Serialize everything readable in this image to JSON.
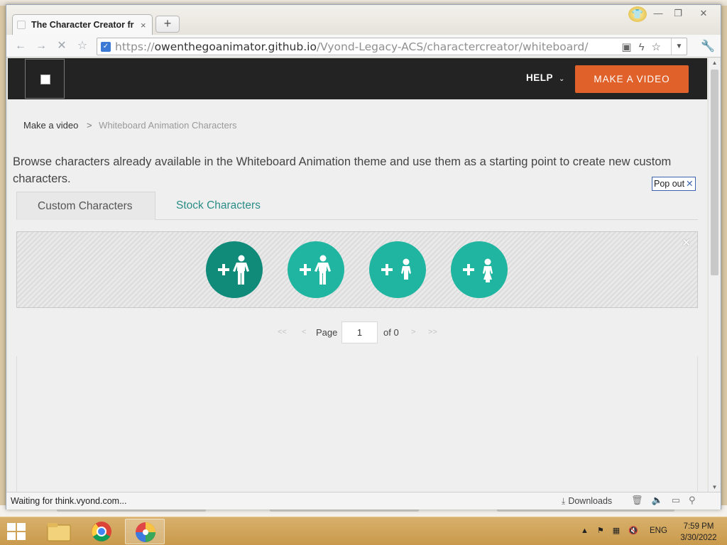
{
  "browser": {
    "tab_title": "The Character Creator fr",
    "tab_close": "×",
    "new_tab": "+",
    "url_scheme": "https://",
    "url_host": "owenthegoanimator.github.io",
    "url_path": "/Vyond-Legacy-ACS/charactercreator/whiteboard/",
    "window_controls": [
      "—",
      "❐",
      "✕"
    ],
    "status_text": "Waiting for think.vyond.com...",
    "downloads_label": "Downloads"
  },
  "site_header": {
    "help_label": "HELP",
    "make_video_label": "MAKE A VIDEO"
  },
  "breadcrumb": {
    "home": "Make a video",
    "separator": ">",
    "current": "Whiteboard Animation Characters"
  },
  "intro_text": "Browse characters already available in the Whiteboard Animation theme and use them as a starting point to create new custom characters.",
  "popout": {
    "label": "Pop out",
    "close": "✕"
  },
  "tabs": [
    {
      "label": "Custom Characters",
      "active": true
    },
    {
      "label": "Stock Characters",
      "active": false
    }
  ],
  "character_buttons": [
    {
      "icon": "add-adult-character-icon"
    },
    {
      "icon": "add-adult-character-icon"
    },
    {
      "icon": "add-child-character-icon"
    },
    {
      "icon": "add-child-character-icon"
    }
  ],
  "pager": {
    "first": "<<",
    "prev": "<",
    "page_label": "Page",
    "page_value": "1",
    "of_label": "of 0",
    "next": ">",
    "last": ">>"
  },
  "taskbar": {
    "language": "ENG",
    "time": "7:59 PM",
    "date": "3/30/2022"
  },
  "colors": {
    "accent_teal": "#1fb5a0",
    "accent_teal_dark": "#108a79",
    "cta_orange": "#e0622a",
    "header_bg": "#232323",
    "tab_link": "#2a8d86"
  }
}
